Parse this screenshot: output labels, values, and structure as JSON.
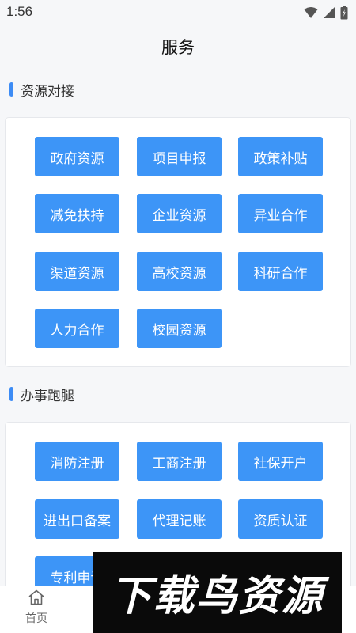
{
  "status_bar": {
    "time": "1:56"
  },
  "header": {
    "title": "服务"
  },
  "sections": [
    {
      "title": "资源对接",
      "buttons": [
        "政府资源",
        "项目申报",
        "政策补贴",
        "减免扶持",
        "企业资源",
        "异业合作",
        "渠道资源",
        "高校资源",
        "科研合作",
        "人力合作",
        "校园资源"
      ]
    },
    {
      "title": "办事跑腿",
      "buttons": [
        "消防注册",
        "工商注册",
        "社保开户",
        "进出口备案",
        "代理记账",
        "资质认证",
        "专利申请"
      ]
    }
  ],
  "tabbar": {
    "home_label": "首页"
  },
  "watermark": {
    "text": "下载鸟资源"
  },
  "colors": {
    "accent": "#3d95f7",
    "section_bar": "#3d8cf5",
    "background": "#f6f7f9"
  }
}
